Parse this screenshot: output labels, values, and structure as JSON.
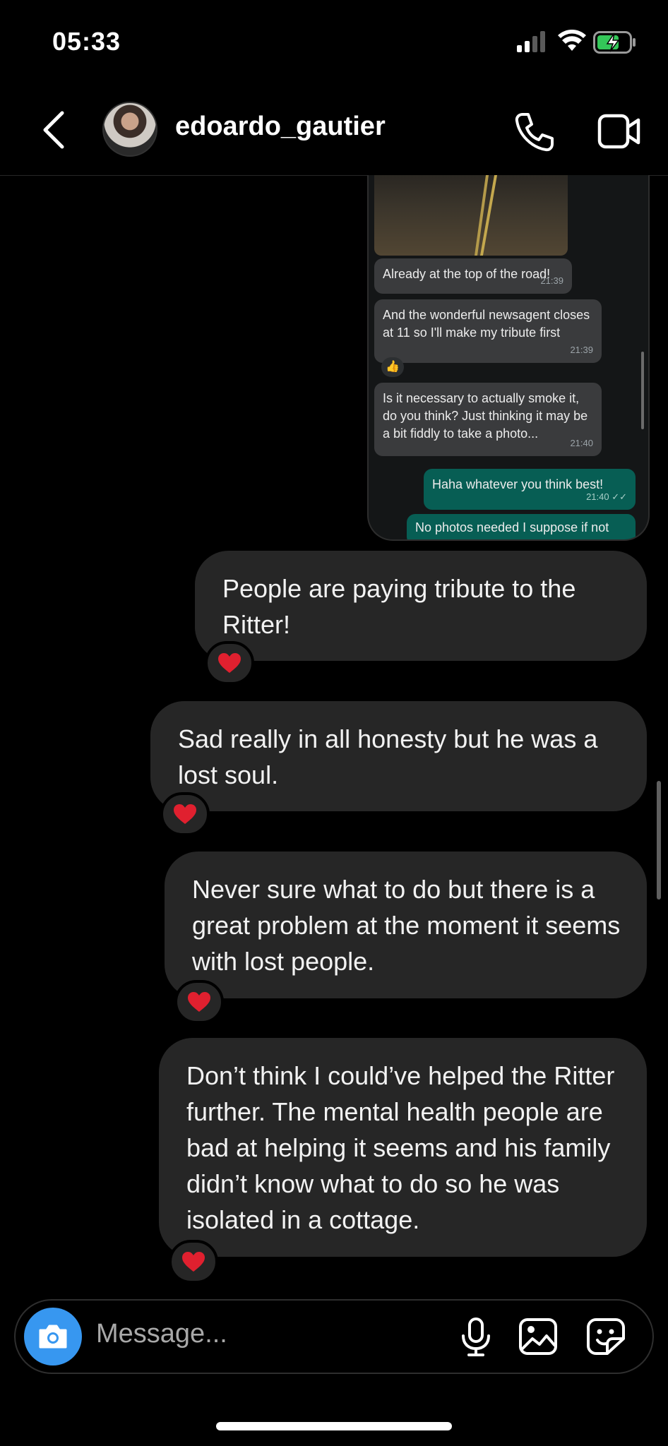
{
  "status": {
    "time": "05:33"
  },
  "header": {
    "username": "edoardo_gautier"
  },
  "attachment": {
    "messages": [
      {
        "text": "Already at the top of the road!",
        "time": "21:39"
      },
      {
        "text": "And the wonderful newsagent closes at 11 so I'll make my tribute first",
        "time": "21:39",
        "reaction": "👍"
      },
      {
        "text": "Is it necessary to actually smoke it, do you think? Just thinking it may be a bit fiddly to take a photo...",
        "time": "21:40"
      },
      {
        "text": "Haha whatever you think best!",
        "time": "21:40 ✓✓"
      },
      {
        "text": "No photos needed I suppose if not",
        "time": ""
      }
    ]
  },
  "messages": [
    {
      "text": "People are paying tribute to the Ritter!",
      "reaction": "heart"
    },
    {
      "text": "Sad really in all honesty but he was a lost soul.",
      "reaction": "heart"
    },
    {
      "text": "Never sure what to do but there is a great problem at the moment it seems with lost people.",
      "reaction": "heart"
    },
    {
      "text": "Don’t think I could’ve helped the Ritter further. The mental health people are bad at helping it seems and his family didn’t know what to do so he was isolated in a cottage.",
      "reaction": "heart"
    }
  ],
  "composer": {
    "placeholder": "Message..."
  },
  "colors": {
    "accent": "#3797f0",
    "bubble": "#262626",
    "whatsapp_sent": "#075e54"
  }
}
